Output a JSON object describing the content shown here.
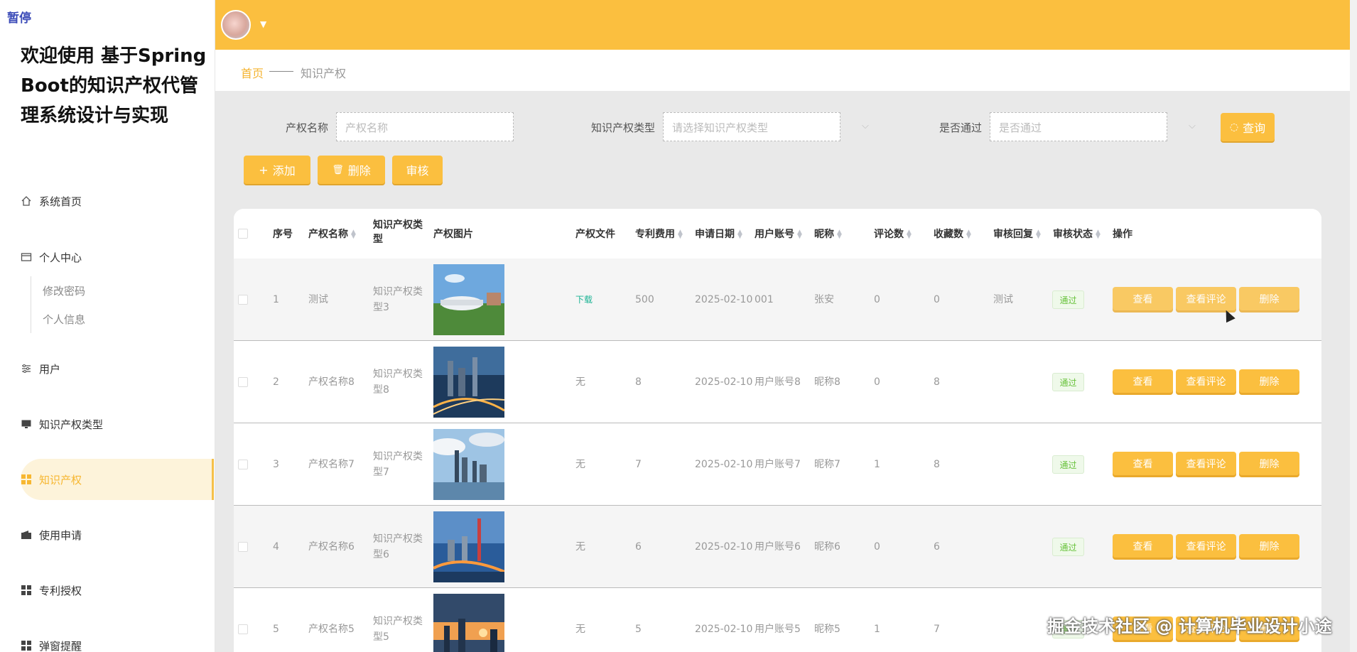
{
  "sidebar": {
    "pause_badge": "暂停",
    "app_title": "欢迎使用 基于SpringBoot的知识产权代管理系统设计与实现",
    "items": [
      {
        "label": "系统首页",
        "icon": "home-icon"
      },
      {
        "label": "个人中心",
        "icon": "profile-icon"
      },
      {
        "label": "修改密码",
        "sub": true
      },
      {
        "label": "个人信息",
        "sub": true
      },
      {
        "label": "用户",
        "icon": "sliders-icon"
      },
      {
        "label": "知识产权类型",
        "icon": "monitor-icon"
      },
      {
        "label": "知识产权",
        "icon": "grid-icon",
        "active": true
      },
      {
        "label": "使用申请",
        "icon": "wallet-icon"
      },
      {
        "label": "专利授权",
        "icon": "grid-icon"
      },
      {
        "label": "弹窗提醒",
        "icon": "grid-icon"
      }
    ]
  },
  "breadcrumb": {
    "home": "首页",
    "current": "知识产权"
  },
  "filters": {
    "name_label": "产权名称",
    "name_placeholder": "产权名称",
    "type_label": "知识产权类型",
    "type_placeholder": "请选择知识产权类型",
    "pass_label": "是否通过",
    "pass_placeholder": "是否通过",
    "search_btn": "查询"
  },
  "actions": {
    "add": "添加",
    "delete": "删除",
    "audit": "审核"
  },
  "table": {
    "headers": {
      "index": "序号",
      "name": "产权名称",
      "type": "知识产权类型",
      "image": "产权图片",
      "file": "产权文件",
      "fee": "专利费用",
      "date": "申请日期",
      "account": "用户账号",
      "nickname": "昵称",
      "comments": "评论数",
      "favorites": "收藏数",
      "reply": "审核回复",
      "status": "审核状态",
      "ops": "操作"
    },
    "rows": [
      {
        "index": "1",
        "name": "测试",
        "type": "知识产权类型3",
        "file": "下载",
        "fee": "500",
        "date": "2025-02-10",
        "account": "001",
        "nickname": "张安",
        "comments": "0",
        "favorites": "0",
        "reply": "测试",
        "status": "通过"
      },
      {
        "index": "2",
        "name": "产权名称8",
        "type": "知识产权类型8",
        "file": "无",
        "fee": "8",
        "date": "2025-02-10",
        "account": "用户账号8",
        "nickname": "昵称8",
        "comments": "0",
        "favorites": "8",
        "reply": "",
        "status": "通过"
      },
      {
        "index": "3",
        "name": "产权名称7",
        "type": "知识产权类型7",
        "file": "无",
        "fee": "7",
        "date": "2025-02-10",
        "account": "用户账号7",
        "nickname": "昵称7",
        "comments": "1",
        "favorites": "8",
        "reply": "",
        "status": "通过"
      },
      {
        "index": "4",
        "name": "产权名称6",
        "type": "知识产权类型6",
        "file": "无",
        "fee": "6",
        "date": "2025-02-10",
        "account": "用户账号6",
        "nickname": "昵称6",
        "comments": "0",
        "favorites": "6",
        "reply": "",
        "status": "通过"
      },
      {
        "index": "5",
        "name": "产权名称5",
        "type": "知识产权类型5",
        "file": "无",
        "fee": "5",
        "date": "2025-02-10",
        "account": "用户账号5",
        "nickname": "昵称5",
        "comments": "1",
        "favorites": "7",
        "reply": "",
        "status": "通过"
      }
    ],
    "row_buttons": {
      "view": "查看",
      "view_comments": "查看评论",
      "delete": "删除"
    }
  },
  "watermark": "掘金技术社区 @ 计算机毕业设计小途",
  "colors": {
    "accent": "#fbbf3f",
    "status_pass": "#67c23a"
  }
}
